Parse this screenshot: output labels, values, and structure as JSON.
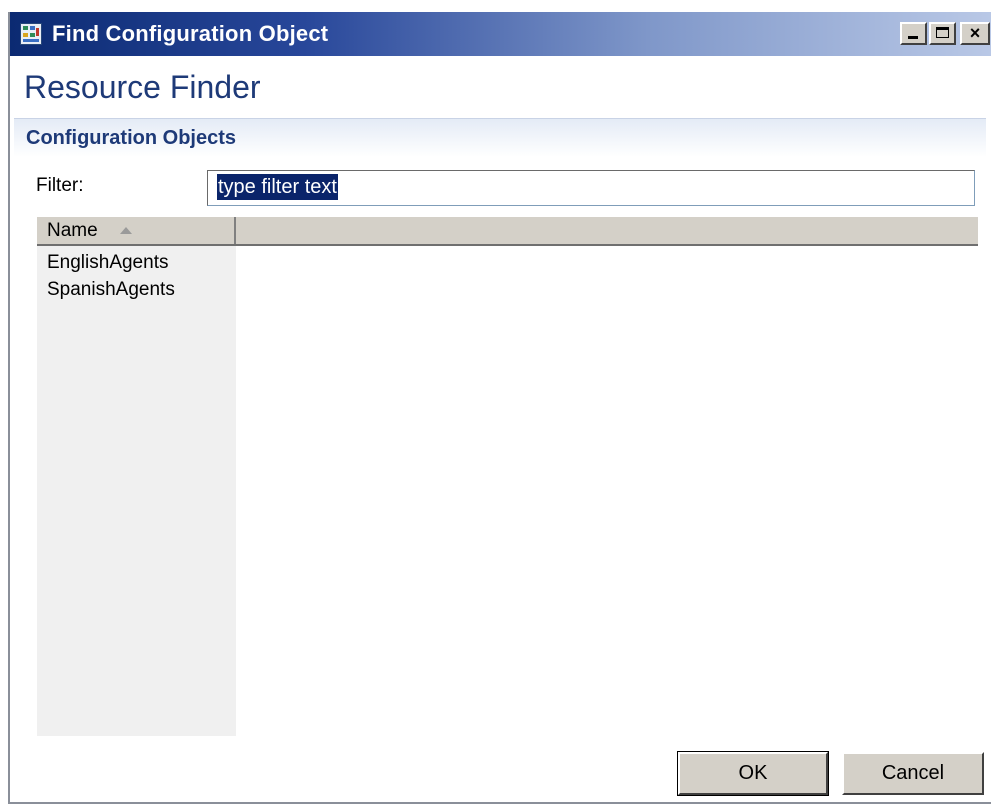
{
  "window": {
    "title": "Find Configuration Object",
    "icon": "config-app-icon",
    "controls": {
      "minimize": "minimize-icon",
      "maximize": "maximize-icon",
      "close": "×"
    }
  },
  "page": {
    "heading": "Resource Finder",
    "section_title": "Configuration Objects"
  },
  "filter": {
    "label": "Filter:",
    "value": "type filter text"
  },
  "table": {
    "columns": [
      {
        "label": "Name",
        "sort": "ascending"
      }
    ],
    "rows": [
      "EnglishAgents",
      "SpanishAgents"
    ]
  },
  "buttons": {
    "ok": "OK",
    "cancel": "Cancel"
  },
  "colors": {
    "title_bar_start": "#0b2a72",
    "heading": "#1e3a78",
    "selection": "#0a246a"
  }
}
